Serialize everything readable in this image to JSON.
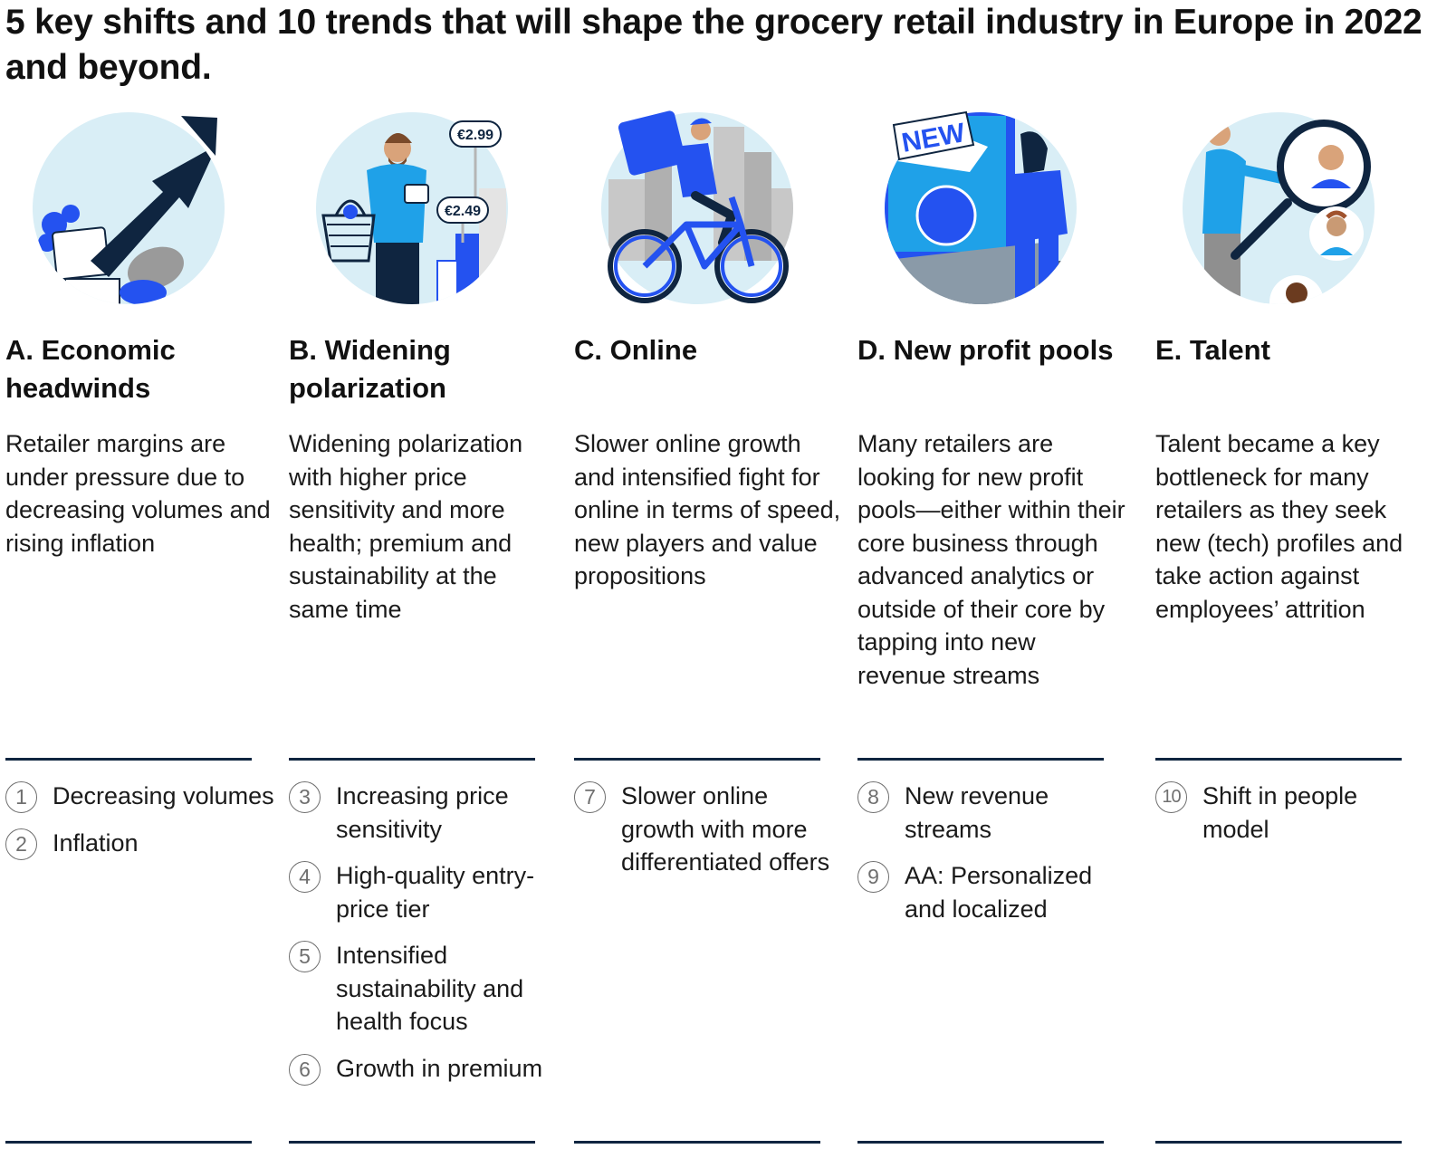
{
  "title": "5 key shifts and 10 trends that will shape the grocery retail industry in Europe in 2022 and beyond.",
  "colors": {
    "circle": "#d9eef6",
    "navy": "#0f2540",
    "blue": "#2452f0",
    "sky": "#1fa1e8"
  },
  "shifts": [
    {
      "heading": "A. Economic headwinds",
      "description": "Retailer margins are under pressure due to decreasing volumes and rising inflation",
      "illustration": "rising-arrow-groceries-icon",
      "trends": [
        {
          "num": "1",
          "label": "Decreasing volumes"
        },
        {
          "num": "2",
          "label": "Inflation"
        }
      ]
    },
    {
      "heading": "B. Widening polarization",
      "description": "Widening polarization with higher price sensitivity and more health; premium and sustainability at the same time",
      "illustration": "shopper-price-tags-icon",
      "price_tag_1": "€2.99",
      "price_tag_2": "€2.49",
      "trends": [
        {
          "num": "3",
          "label": "Increasing price sensitivity"
        },
        {
          "num": "4",
          "label": "High-quality entry-price tier"
        },
        {
          "num": "5",
          "label": "Intensified sustainability and health focus"
        },
        {
          "num": "6",
          "label": "Growth in premium"
        }
      ]
    },
    {
      "heading": "C. Online",
      "description": "Slower online growth and intensified fight for online in terms of speed, new players and value propositions",
      "illustration": "delivery-cyclist-icon",
      "trends": [
        {
          "num": "7",
          "label": "Slower online growth with more differentiated offers"
        }
      ]
    },
    {
      "heading": "D. New profit pools",
      "description": "Many retailers are looking for new profit pools—either within their core business through advanced analytics or outside of their core by tapping into new revenue streams",
      "illustration": "new-revenue-screen-icon",
      "badge": "NEW",
      "trends": [
        {
          "num": "8",
          "label": "New revenue streams"
        },
        {
          "num": "9",
          "label": "AA: Personalized and localized"
        }
      ]
    },
    {
      "heading": "E. Talent",
      "description": "Talent became a key bottleneck for many retailers as they seek new (tech) profiles and take action against employees’ attrition",
      "illustration": "magnifier-talent-icon",
      "trends": [
        {
          "num": "10",
          "label": "Shift in people model"
        }
      ]
    }
  ]
}
